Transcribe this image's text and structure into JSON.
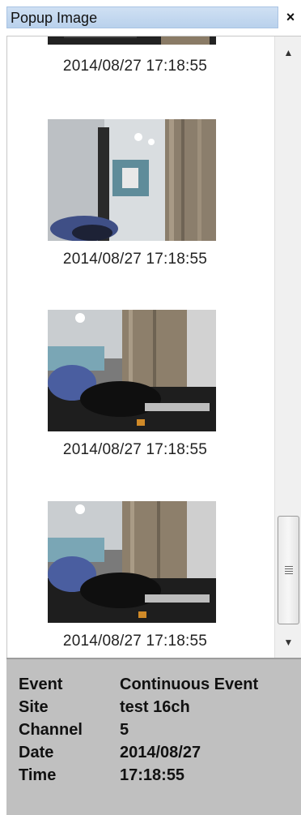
{
  "window": {
    "title": "Popup Image",
    "close_label": "×"
  },
  "thumbnails": [
    {
      "timestamp": "2014/08/27 17:18:55"
    },
    {
      "timestamp": "2014/08/27 17:18:55"
    },
    {
      "timestamp": "2014/08/27 17:18:55"
    },
    {
      "timestamp": "2014/08/27 17:18:55"
    }
  ],
  "scrollbar": {
    "up_label": "▲",
    "down_label": "▼"
  },
  "info": {
    "event_label": "Event",
    "event_value": "Continuous Event",
    "site_label": "Site",
    "site_value": "test 16ch",
    "channel_label": "Channel",
    "channel_value": "5",
    "date_label": "Date",
    "date_value": "2014/08/27",
    "time_label": "Time",
    "time_value": "17:18:55"
  },
  "colors": {
    "title_strip": "#b9d1ec",
    "info_panel": "#c0c0c0"
  }
}
